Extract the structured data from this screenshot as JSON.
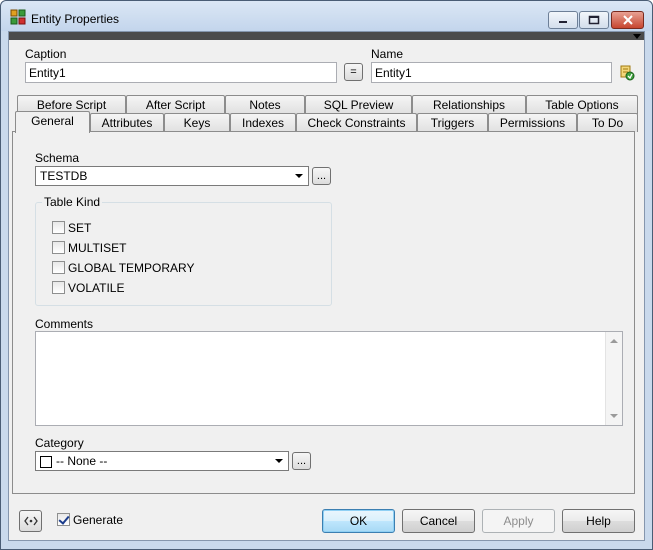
{
  "window": {
    "title": "Entity Properties"
  },
  "caption": {
    "label": "Caption",
    "value": "Entity1"
  },
  "equal_button": "=",
  "name": {
    "label": "Name",
    "value": "Entity1"
  },
  "tabs_row1": [
    "Before Script",
    "After Script",
    "Notes",
    "SQL Preview",
    "Relationships",
    "Table Options"
  ],
  "tabs_row2": [
    "General",
    "Attributes",
    "Keys",
    "Indexes",
    "Check Constraints",
    "Triggers",
    "Permissions",
    "To Do"
  ],
  "active_tab": "General",
  "general": {
    "schema_label": "Schema",
    "schema_value": "TESTDB",
    "browse_label": "...",
    "table_kind_title": "Table Kind",
    "table_kinds": [
      {
        "label": "SET",
        "checked": false
      },
      {
        "label": "MULTISET",
        "checked": false
      },
      {
        "label": "GLOBAL TEMPORARY",
        "checked": false
      },
      {
        "label": "VOLATILE",
        "checked": false
      }
    ],
    "comments_label": "Comments",
    "comments_value": "",
    "category_label": "Category",
    "category_value": "-- None --"
  },
  "footer": {
    "generate_label": "Generate",
    "generate_checked": true,
    "ok": "OK",
    "cancel": "Cancel",
    "apply": "Apply",
    "help": "Help"
  }
}
